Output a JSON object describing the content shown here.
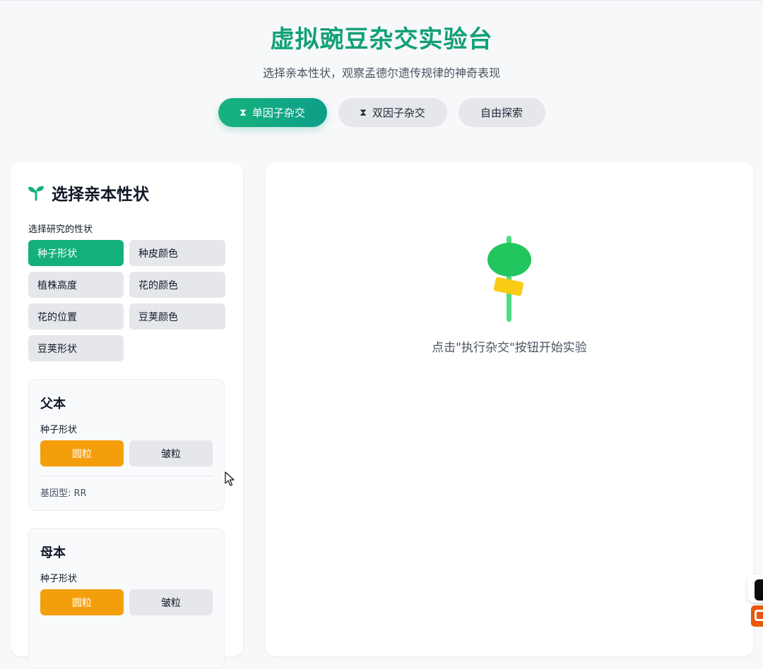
{
  "header": {
    "title": "虚拟豌豆杂交实验台",
    "subtitle": "选择亲本性状，观察孟德尔遗传规律的神奇表现"
  },
  "mode_tabs": [
    {
      "label": "单因子杂交",
      "icon": "hourglass-icon",
      "active": true
    },
    {
      "label": "双因子杂交",
      "icon": "hourglass-icon",
      "active": false
    },
    {
      "label": "自由探索",
      "icon": "",
      "active": false
    }
  ],
  "left_panel": {
    "title": "选择亲本性状",
    "title_icon": "sprout-icon",
    "trait_section_label": "选择研究的性状",
    "traits": [
      {
        "label": "种子形状",
        "active": true
      },
      {
        "label": "种皮颜色",
        "active": false
      },
      {
        "label": "植株高度",
        "active": false
      },
      {
        "label": "花的颜色",
        "active": false
      },
      {
        "label": "花的位置",
        "active": false
      },
      {
        "label": "豆荚颜色",
        "active": false
      },
      {
        "label": "豆荚形状",
        "active": false
      }
    ],
    "father": {
      "title": "父本",
      "trait_label": "种子形状",
      "options": [
        {
          "label": "圆粒",
          "active": true
        },
        {
          "label": "皱粒",
          "active": false
        }
      ],
      "genotype": "基因型: RR"
    },
    "mother": {
      "title": "母本",
      "trait_label": "种子形状",
      "options": [
        {
          "label": "圆粒",
          "active": true
        },
        {
          "label": "皱粒",
          "active": false
        }
      ]
    }
  },
  "right_panel": {
    "illustration_icon": "pea-plant-icon",
    "hint": "点击\"执行杂交\"按钮开始实验"
  },
  "colors": {
    "accent_green": "#13b07c",
    "title_green": "#11a076",
    "option_orange": "#f59e0b",
    "inactive_gray": "#e5e7eb"
  }
}
